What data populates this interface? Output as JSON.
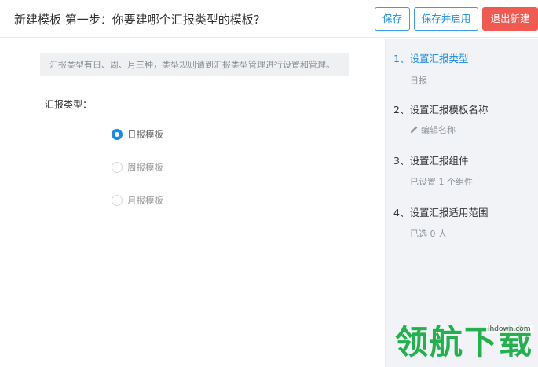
{
  "header": {
    "title": "新建模板 第一步：你要建哪个汇报类型的模板?",
    "save_label": "保存",
    "save_enable_label": "保存并启用",
    "exit_label": "退出新建"
  },
  "main": {
    "notice": "汇报类型有日、周、月三种，类型规则请到汇报类型管理进行设置和管理。",
    "type_label": "汇报类型：",
    "options": [
      {
        "label": "日报模板",
        "checked": true
      },
      {
        "label": "周报模板",
        "checked": false
      },
      {
        "label": "月报模板",
        "checked": false
      }
    ]
  },
  "sidebar": {
    "steps": [
      {
        "title": "1、设置汇报类型",
        "sub": "日报",
        "active": true
      },
      {
        "title": "2、设置汇报模板名称",
        "sub": "编辑名称",
        "icon": "pencil-icon"
      },
      {
        "title": "3、设置汇报组件",
        "sub": "已设置 1 个组件"
      },
      {
        "title": "4、设置汇报适用范围",
        "sub": "已选 0 人"
      }
    ]
  },
  "watermark": {
    "text": "领航下载",
    "url": "lhdown.com"
  },
  "colors": {
    "accent": "#1a8cf0",
    "danger": "#f05a50",
    "sidebar_bg": "#f1f3f6",
    "watermark": "#22b14c"
  }
}
